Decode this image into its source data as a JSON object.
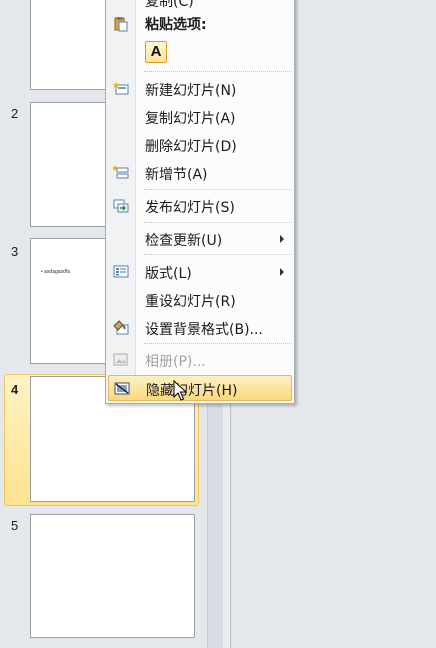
{
  "slides": [
    {
      "number": "",
      "text": "",
      "selected": false
    },
    {
      "number": "2",
      "text": "",
      "selected": false
    },
    {
      "number": "3",
      "text": "• asdagasdfa",
      "selected": false
    },
    {
      "number": "4",
      "text": "",
      "selected": true
    },
    {
      "number": "5",
      "text": "",
      "selected": false
    }
  ],
  "menu": {
    "top_item": {
      "label": "复制(C)",
      "disabled": false
    },
    "paste_header": "粘贴选项:",
    "paste_option": "A",
    "items": [
      {
        "label": "新建幻灯片(N)",
        "mnemonic": "N",
        "icon": "new-slide-icon"
      },
      {
        "label": "复制幻灯片(A)",
        "mnemonic": "A",
        "icon": "none"
      },
      {
        "label": "删除幻灯片(D)",
        "mnemonic": "D",
        "icon": "none"
      },
      {
        "label": "新增节(A)",
        "mnemonic": "A",
        "icon": "add-section-icon"
      },
      {
        "label": "发布幻灯片(S)",
        "mnemonic": "S",
        "icon": "publish-slides-icon"
      },
      {
        "label": "检查更新(U)",
        "mnemonic": "U",
        "icon": "none",
        "submenu": true
      },
      {
        "label": "版式(L)",
        "mnemonic": "L",
        "icon": "layout-icon",
        "submenu": true
      },
      {
        "label": "重设幻灯片(R)",
        "mnemonic": "R",
        "icon": "none"
      },
      {
        "label": "设置背景格式(B)...",
        "mnemonic": "B",
        "icon": "format-background-icon"
      },
      {
        "label": "相册(P)...",
        "mnemonic": "P",
        "icon": "photo-album-icon",
        "disabled": true
      },
      {
        "label": "隐藏幻灯片(H)",
        "mnemonic": "H",
        "icon": "hide-slide-icon",
        "hover": true
      }
    ]
  },
  "colors": {
    "hover_gradient_top": "#fdf0c4",
    "hover_gradient_bottom": "#fbd97b",
    "selected_slide": "#fde38f"
  }
}
